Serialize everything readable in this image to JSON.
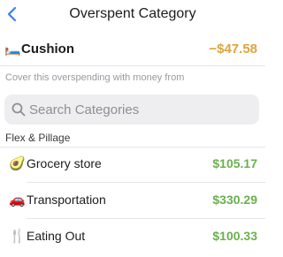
{
  "nav": {
    "title": "Overspent Category",
    "back_icon": "chevron-left-icon",
    "accent": "#3a7ff6"
  },
  "overspent": {
    "emoji": "🛏️",
    "label": "Cushion",
    "amount": "−$47.58",
    "amount_color": "#e0a33b"
  },
  "hint": "Cover this overspending with money from",
  "search": {
    "placeholder": "Search Categories",
    "value": ""
  },
  "group": {
    "name": "Flex & Pillage",
    "categories": [
      {
        "emoji": "🥑",
        "label": "Grocery store",
        "amount": "$105.17"
      },
      {
        "emoji": "🚗",
        "label": "Transportation",
        "amount": "$330.29"
      },
      {
        "emoji": "🍴",
        "label": "Eating Out",
        "amount": "$100.33"
      }
    ]
  },
  "positive_color": "#6ab04c"
}
